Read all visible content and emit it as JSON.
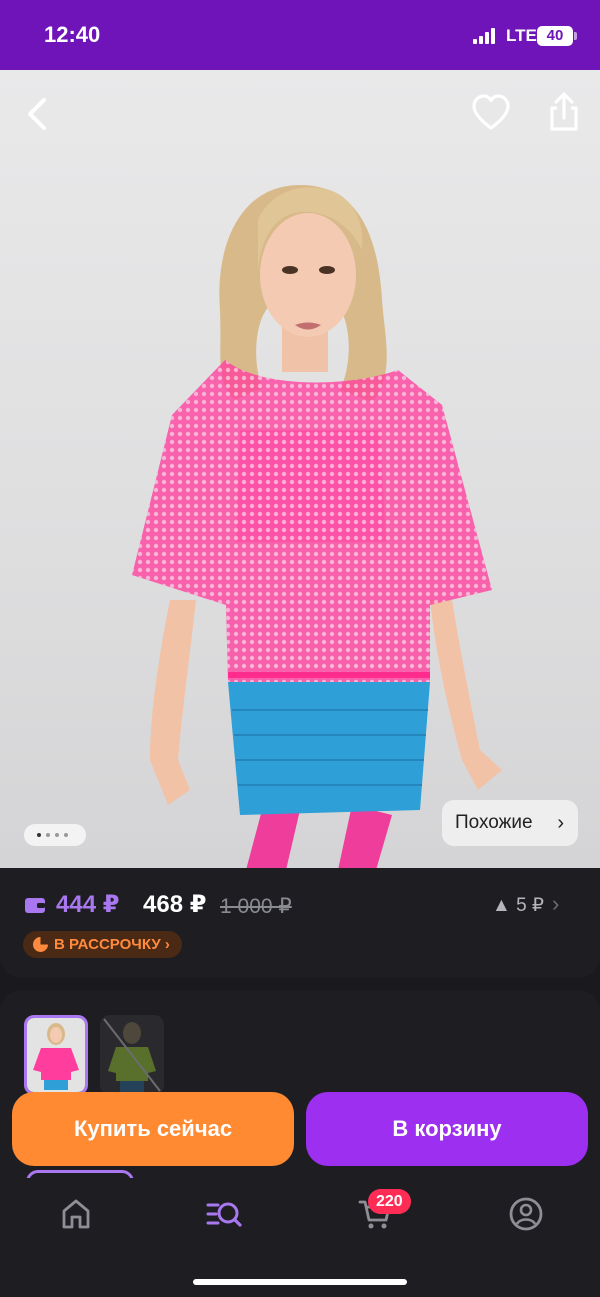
{
  "status_bar": {
    "time": "12:40",
    "network": "LTE",
    "battery": "40"
  },
  "product": {
    "images_count": 4,
    "active_image": 1,
    "similar_label": "Похожие",
    "similar_chevron": "›"
  },
  "prices": {
    "wallet_price": "444 ₽",
    "price": "468 ₽",
    "old_price": "1 000 ₽",
    "price_change": "▲ 5 ₽",
    "installment_label": "В РАССРОЧКУ ›"
  },
  "actions": {
    "buy_now": "Купить сейчас",
    "add_to_cart": "В корзину"
  },
  "tabbar": {
    "cart_count": "220",
    "items": [
      "home-icon",
      "catalog-search-icon",
      "cart-icon",
      "profile-icon"
    ]
  },
  "colors": {
    "status_bar": "#6e14b8",
    "wallet_price": "#a978f0",
    "buy_button": "#ff8a32",
    "cart_button": "#9c2ff0",
    "badge": "#ff2d55",
    "installment_text": "#ff8a3d"
  }
}
